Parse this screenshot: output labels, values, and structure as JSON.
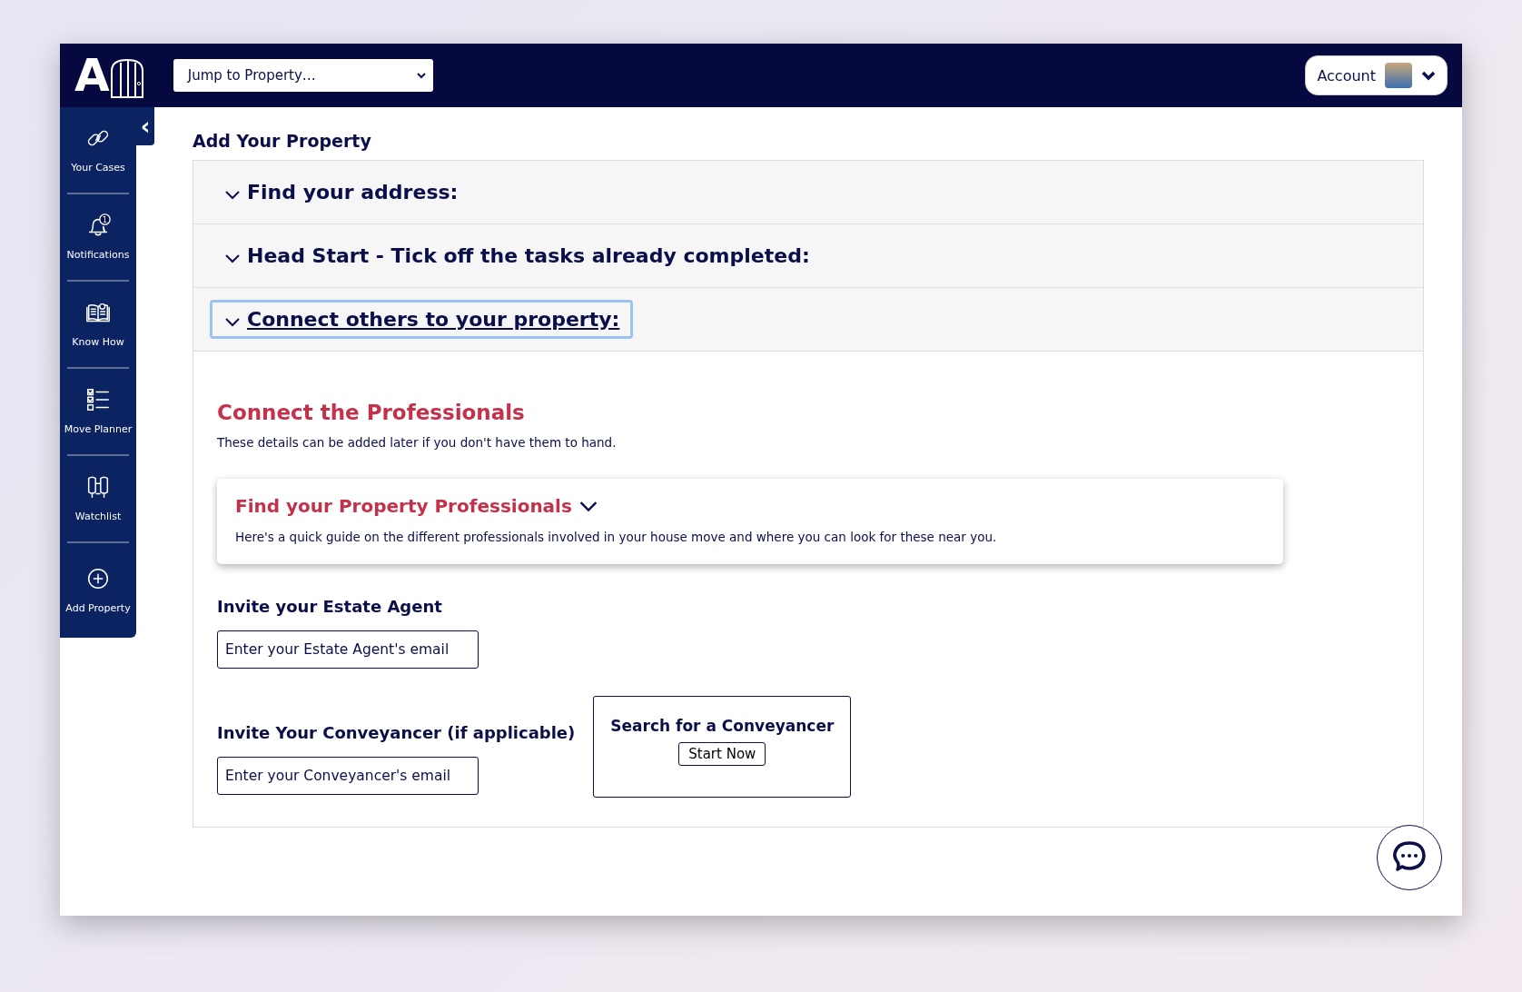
{
  "header": {
    "logo_letter": "A",
    "jump_select": {
      "value": "Jump to Property…"
    },
    "account": {
      "label": "Account"
    }
  },
  "sidebar": {
    "collapse_button": "‹",
    "items": [
      {
        "kind": "cases",
        "label": "Your Cases"
      },
      {
        "kind": "notifications",
        "label": "Notifications",
        "badge": "1"
      },
      {
        "kind": "knowhow",
        "label": "Know How"
      },
      {
        "kind": "planner",
        "label": "Move Planner"
      },
      {
        "kind": "watchlist",
        "label": "Watchlist"
      },
      {
        "kind": "add",
        "label": "Add Property"
      }
    ]
  },
  "page_title": "Add Your Property",
  "accordion": [
    {
      "title": "Find your address:",
      "focused": false
    },
    {
      "title": "Head Start - Tick off the tasks already completed:",
      "focused": false
    },
    {
      "title": "Connect others to your property:",
      "focused": true
    }
  ],
  "connect": {
    "heading": "Connect the Professionals",
    "note": "These details can be added later if you don't have them to hand.",
    "guide_card": {
      "title": "Find your Property Professionals",
      "text": "Here's a quick guide on the different professionals involved in your house move and where you can look for these near you."
    },
    "estate_agent": {
      "label": "Invite your Estate Agent",
      "placeholder": "Enter your Estate Agent's email"
    },
    "conveyancer": {
      "label": "Invite Your Conveyancer (if applicable)",
      "placeholder": "Enter your Conveyancer's email"
    },
    "search_box": {
      "title": "Search for a Conveyancer",
      "button": "Start Now"
    }
  }
}
